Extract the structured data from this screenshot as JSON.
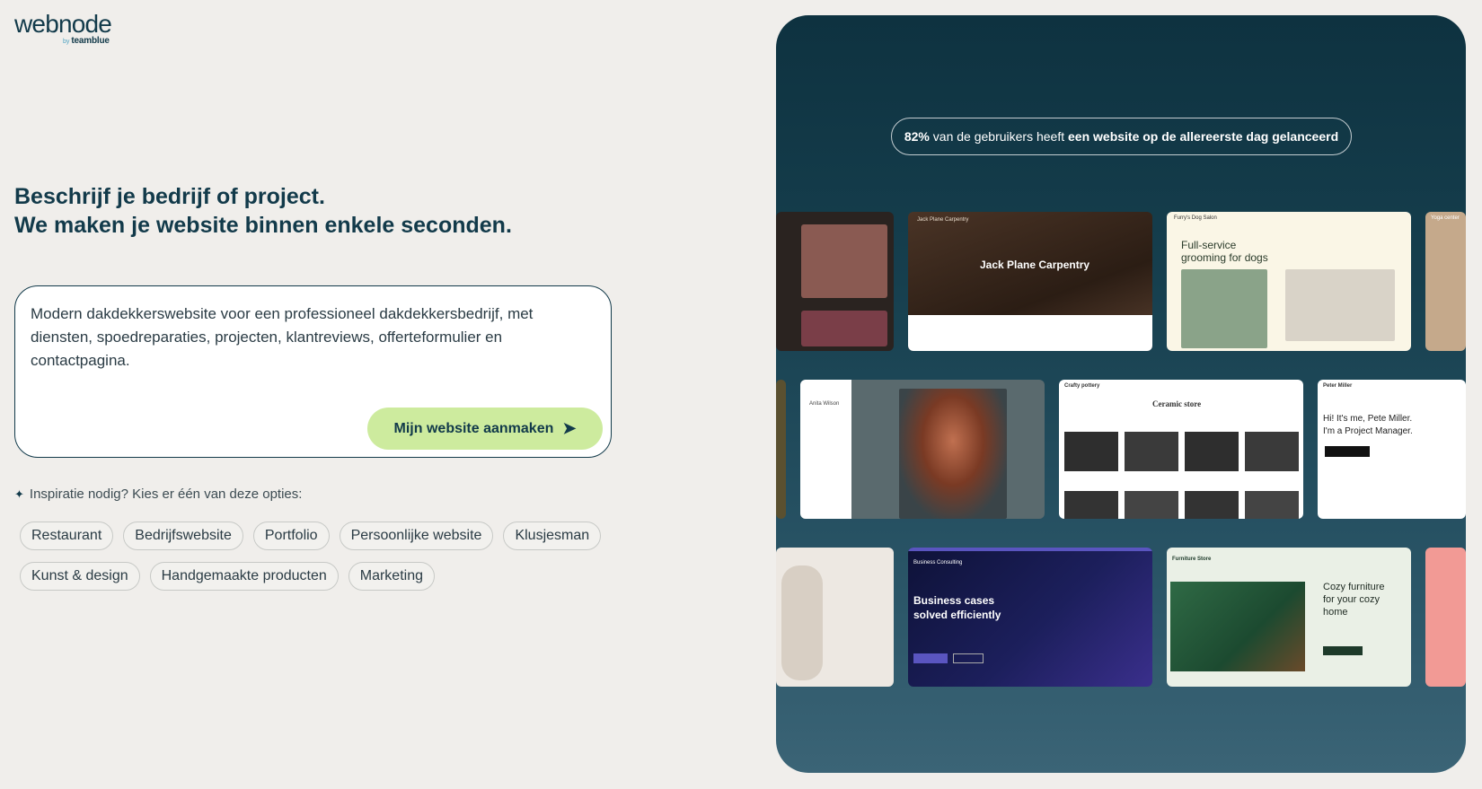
{
  "logo": {
    "main": "webnode",
    "by": "by",
    "brand": "teamblue"
  },
  "headline": {
    "line1": "Beschrijf je bedrijf of project.",
    "line2": "We maken je website binnen enkele seconden."
  },
  "prompt": {
    "value": "Modern dakdekkerswebsite voor een professioneel dakdekkersbedrijf, met diensten, spoedreparaties, projecten, klantreviews, offerteformulier en contactpagina.",
    "button_label": "Mijn website aanmaken",
    "button_icon": "arrow-right-icon"
  },
  "inspiration": {
    "icon": "sparkle-icon",
    "label": "Inspiratie nodig? Kies er één van deze opties:",
    "chips_row1": [
      "Restaurant",
      "Bedrijfswebsite",
      "Portfolio",
      "Persoonlijke website",
      "Klusjesman"
    ],
    "chips_row2": [
      "Kunst & design",
      "Handgemaakte producten",
      "Marketing"
    ]
  },
  "panel": {
    "stat_bold1": "82%",
    "stat_mid": " van de gebruikers heeft ",
    "stat_bold2": "een website op de allereerste dag gelanceerd",
    "templates": {
      "carpentry": {
        "brand": "Jack Plane Carpentry",
        "title": "Jack Plane Carpentry"
      },
      "dogs": {
        "brand": "Furry's Dog Salon",
        "title_line1": "Full-service",
        "title_line2": "grooming for dogs"
      },
      "yoga": {
        "brand": "Yoga center"
      },
      "anita": {
        "name": "Anita Wilson"
      },
      "pottery": {
        "brand": "Crafty pottery",
        "title": "Ceramic store"
      },
      "pete": {
        "brand": "Peter Miller",
        "line1": "Hi! It's me, Pete Miller.",
        "line2": "I'm a Project Manager."
      },
      "business": {
        "brand": "Business Consulting",
        "title_line1": "Business cases",
        "title_line2": "solved efficiently"
      },
      "furniture": {
        "brand": "Furniture Store",
        "title_line1": "Cozy furniture",
        "title_line2": "for your cozy",
        "title_line3": "home"
      }
    }
  },
  "colors": {
    "accent_button": "#cdeb9e",
    "primary_text": "#123a4a",
    "panel_bg": "#163f4e"
  }
}
